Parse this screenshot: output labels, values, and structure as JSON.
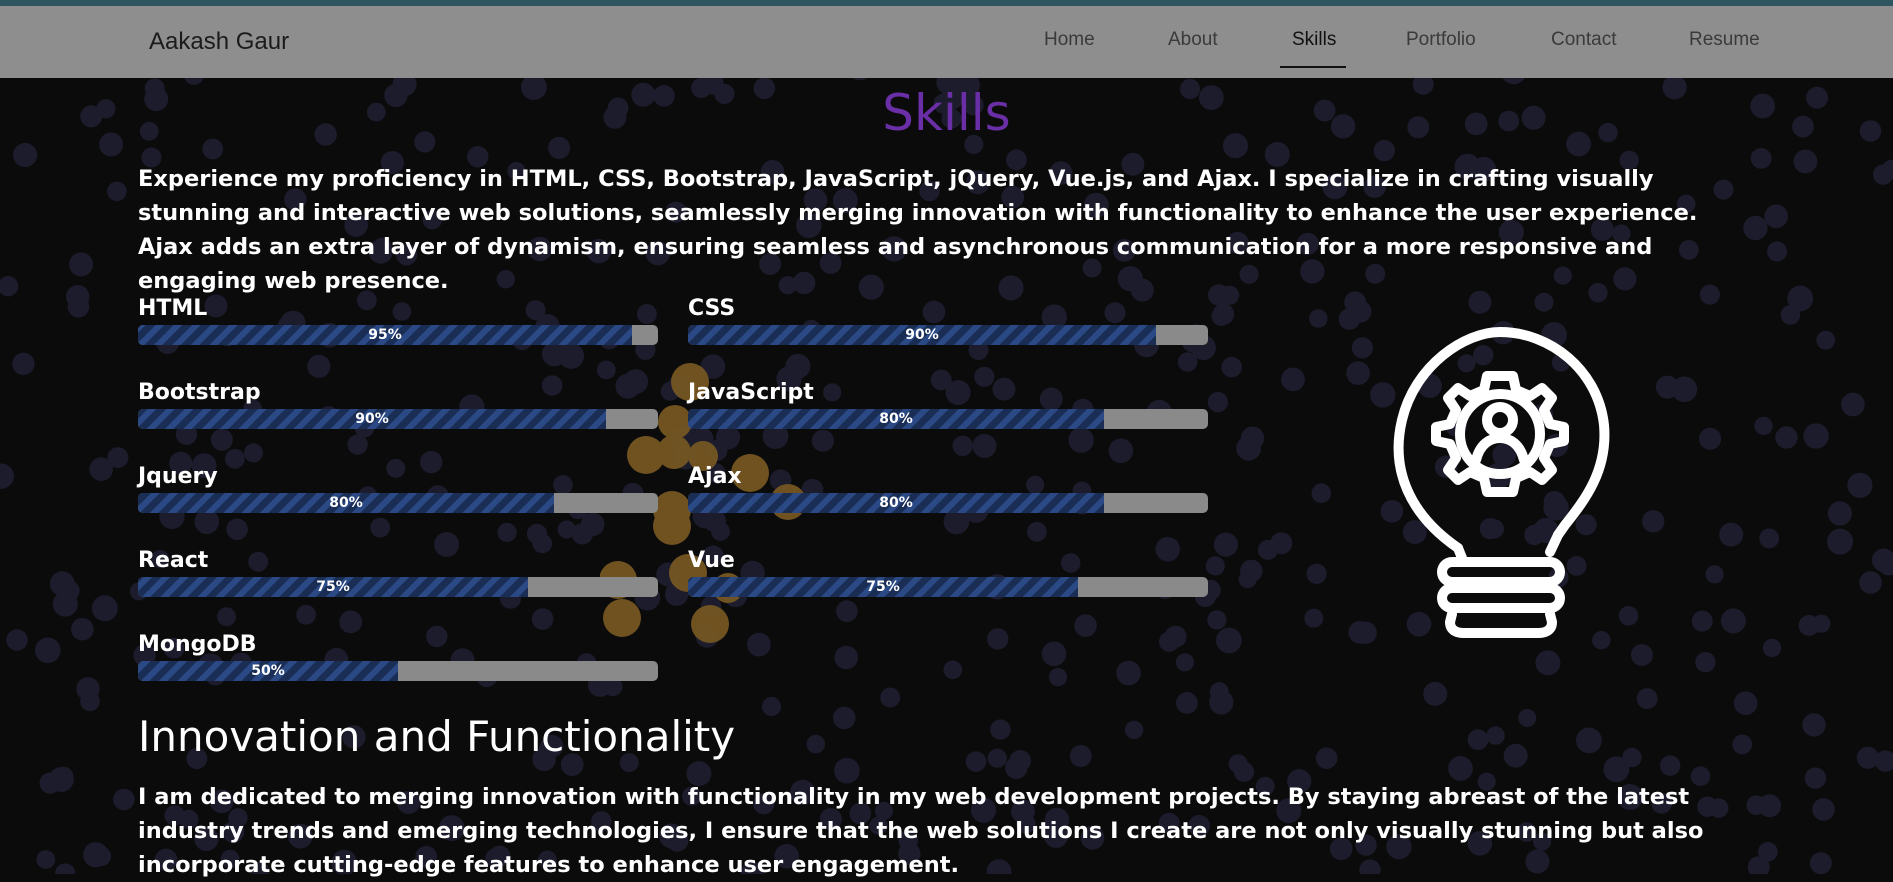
{
  "navbar": {
    "brand": "Aakash Gaur",
    "links": [
      {
        "label": "Home",
        "active": false
      },
      {
        "label": "About",
        "active": false
      },
      {
        "label": "Skills",
        "active": true
      },
      {
        "label": "Portfolio",
        "active": false
      },
      {
        "label": "Contact",
        "active": false
      },
      {
        "label": "Resume",
        "active": false
      }
    ]
  },
  "skills_section": {
    "title": "Skills",
    "intro": "Experience my proficiency in HTML, CSS, Bootstrap, JavaScript, jQuery, Vue.js, and Ajax. I specialize in crafting visually stunning and interactive web solutions, seamlessly merging innovation with functionality to enhance the user experience. Ajax adds an extra layer of dynamism, ensuring seamless and asynchronous communication for a more responsive and engaging web presence.",
    "skills": [
      {
        "name": "HTML",
        "percent_label": "95%",
        "level": 0.95
      },
      {
        "name": "CSS",
        "percent_label": "90%",
        "level": 0.9
      },
      {
        "name": "Bootstrap",
        "percent_label": "90%",
        "level": 0.9
      },
      {
        "name": "JavaScript",
        "percent_label": "80%",
        "level": 0.8
      },
      {
        "name": "Jquery",
        "percent_label": "80%",
        "level": 0.8
      },
      {
        "name": "Ajax",
        "percent_label": "80%",
        "level": 0.8
      },
      {
        "name": "React",
        "percent_label": "75%",
        "level": 0.75
      },
      {
        "name": "Vue",
        "percent_label": "75%",
        "level": 0.75
      },
      {
        "name": "MongoDB",
        "percent_label": "50%",
        "level": 0.5
      }
    ],
    "illustration_icon": "lightbulb-gear-user-icon"
  },
  "innovation_section": {
    "title": "Innovation and Functionality",
    "text": "I am dedicated to merging innovation with functionality in my web development projects. By staying abreast of the latest industry trends and emerging technologies, I ensure that the web solutions I create are not only visually stunning but also incorporate cutting-edge features to enhance user engagement."
  },
  "colors": {
    "background": "#0b0b0c",
    "navbar": "#8e8e8e",
    "title_accent": "#6a2fa6",
    "bar_fill": "#1a2d55",
    "bar_track": "#8a8a8a",
    "particles": "#1c1c2c"
  }
}
